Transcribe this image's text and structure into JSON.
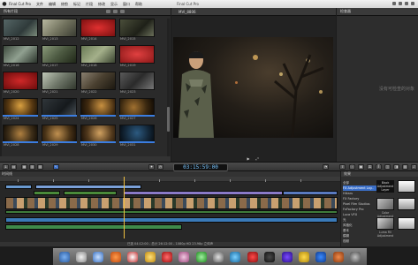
{
  "menubar": {
    "items": [
      "Final Cut Pro",
      "文件",
      "编辑",
      "修剪",
      "标记",
      "片段",
      "修改",
      "显示",
      "窗口",
      "帮助"
    ],
    "window_title": "Final Cut Pro"
  },
  "browser": {
    "header": "所有片段",
    "clips": [
      "MVI_2012",
      "MVI_2013",
      "MVI_2014",
      "MVI_2015",
      "MVI_2016",
      "MVI_2017",
      "MVI_2018",
      "MVI_2019",
      "MVI_2020",
      "MVI_2021",
      "MVI_2022",
      "MVI_2023",
      "MVI_2024",
      "MVI_2025",
      "MVI_2026",
      "MVI_2027",
      "MVI_2028",
      "MVI_2029",
      "MVI_2030",
      "MVI_2031"
    ]
  },
  "viewer": {
    "header": "MVI_8806"
  },
  "inspector": {
    "header": "检查器",
    "empty_text": "没有可检查的对象"
  },
  "toolbar": {
    "timecode": "03:15:59:00"
  },
  "timeline": {
    "header": "时间线",
    "footer": "已选 04:12:00 - 总计 26:12:00 - 1080p HD 23.98p 立体声"
  },
  "effects": {
    "header": "效果",
    "categories": [
      "全部",
      "FX Adjustment Lay..",
      "Hikaru",
      "FX Factory",
      "Pixel Film Studios",
      "FxFactory Pro",
      "Luca VFX",
      "光",
      "风格化",
      "基本",
      "模糊",
      "视频"
    ],
    "selected_index": 1,
    "thumbs": [
      "Black Adjustment Layer",
      "",
      "Color Adjustment",
      "",
      "Luma Fill Adjustment",
      ""
    ]
  },
  "colors": {
    "accent": "#3b7de0",
    "timecode": "#78c5ff"
  }
}
